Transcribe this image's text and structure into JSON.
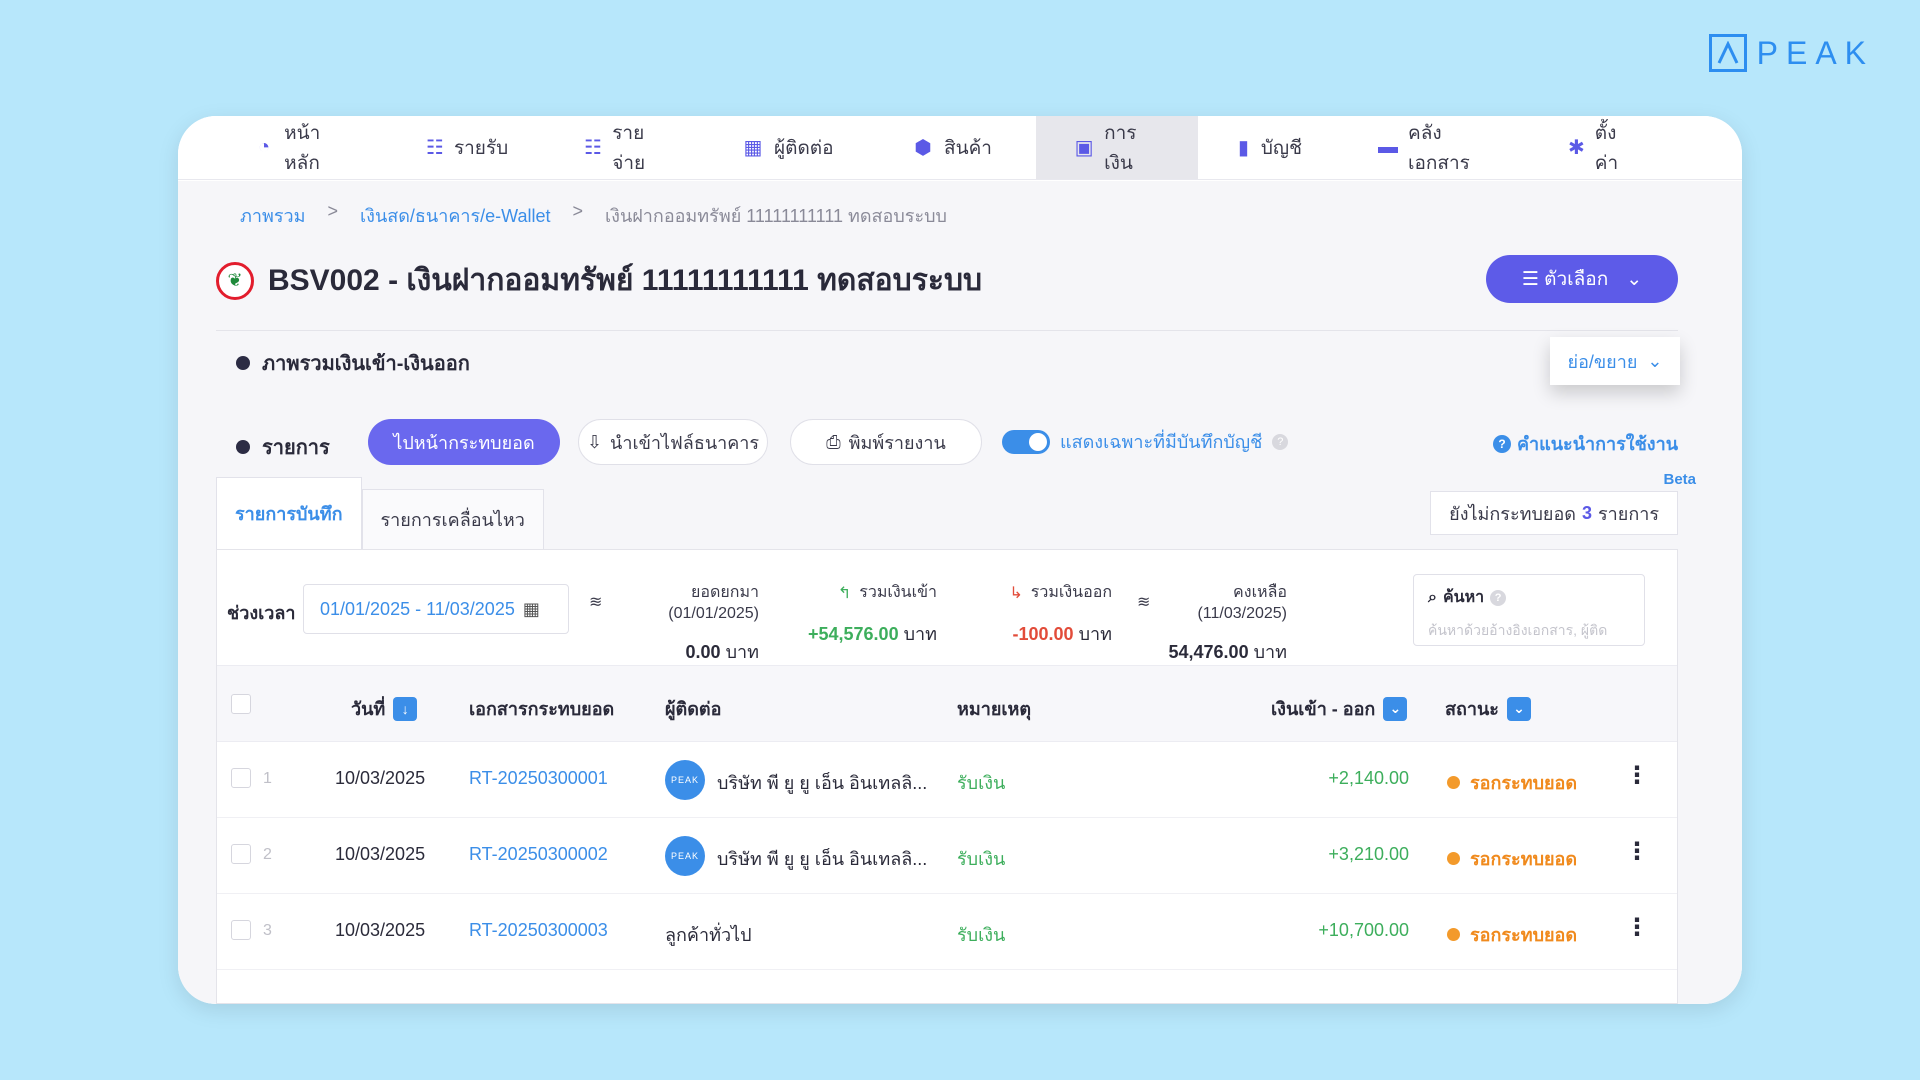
{
  "brand": {
    "name": "PEAK"
  },
  "nav": [
    {
      "label": "หน้าหลัก",
      "icon": "dashboard-icon",
      "glyph": "◔"
    },
    {
      "label": "รายรับ",
      "icon": "income-list-icon",
      "glyph": "☷"
    },
    {
      "label": "รายจ่าย",
      "icon": "expense-list-icon",
      "glyph": "☷"
    },
    {
      "label": "ผู้ติดต่อ",
      "icon": "contacts-icon",
      "glyph": "▦"
    },
    {
      "label": "สินค้า",
      "icon": "product-box-icon",
      "glyph": "⬢"
    },
    {
      "label": "การเงิน",
      "icon": "money-icon",
      "glyph": "▣"
    },
    {
      "label": "บัญชี",
      "icon": "ledger-book-icon",
      "glyph": "▮"
    },
    {
      "label": "คลังเอกสาร",
      "icon": "folder-icon",
      "glyph": "▬"
    },
    {
      "label": "ตั้งค่า",
      "icon": "gear-icon",
      "glyph": "✱"
    }
  ],
  "breadcrumb": {
    "item1": "ภาพรวม",
    "item2": "เงินสด/ธนาคาร/e-Wallet",
    "item3": "เงินฝากออมทรัพย์ 11111111111 ทดสอบระบบ",
    "sep": ">"
  },
  "page": {
    "title": "BSV002 - เงินฝากออมทรัพย์ 11111111111 ทดสอบระบบ",
    "options_label": "ตัวเลือก"
  },
  "overview": {
    "heading": "ภาพรวมเงินเข้า-เงินออก",
    "collapse_label": "ย่อ/ขยาย"
  },
  "transactions": {
    "heading": "รายการ",
    "reconcile_button": "ไปหน้ากระทบยอด",
    "import_button": "นำเข้าไฟล์ธนาคาร",
    "print_button": "พิมพ์รายงาน",
    "toggle_label": "แสดงเฉพาะที่มีบันทึกบัญชี",
    "help_label": "คำแนะนำการใช้งาน",
    "beta": "Beta"
  },
  "tabs": {
    "recorded": "รายการบันทึก",
    "movements": "รายการเคลื่อนไหว"
  },
  "pending": {
    "prefix": "ยังไม่กระทบยอด",
    "count": "3",
    "suffix": "รายการ"
  },
  "filters": {
    "period_label": "ช่วงเวลา",
    "date_range": "01/01/2025 - 11/03/2025",
    "opening": {
      "label": "ยอดยกมา (01/01/2025)",
      "value": "0.00",
      "unit": "บาท"
    },
    "total_in": {
      "label": "รวมเงินเข้า",
      "value": "+54,576.00",
      "unit": "บาท"
    },
    "total_out": {
      "label": "รวมเงินออก",
      "value": "-100.00",
      "unit": "บาท"
    },
    "balance": {
      "label": "คงเหลือ (11/03/2025)",
      "value": "54,476.00",
      "unit": "บาท"
    },
    "search_label": "ค้นหา",
    "search_placeholder": "ค้นหาด้วยอ้างอิงเอกสาร, ผู้ติด"
  },
  "table": {
    "headers": {
      "date": "วันที่",
      "doc": "เอกสารกระทบยอด",
      "contact": "ผู้ติดต่อ",
      "note": "หมายเหตุ",
      "amount": "เงินเข้า - ออก",
      "status": "สถานะ"
    },
    "rows": [
      {
        "num": "1",
        "date": "10/03/2025",
        "doc": "RT-20250300001",
        "contact": "บริษัท พี ยู ยู เอ็น อินเทลลิ...",
        "has_avatar": true,
        "note": "รับเงิน",
        "amount": "+2,140.00",
        "status": "รอกระทบยอด"
      },
      {
        "num": "2",
        "date": "10/03/2025",
        "doc": "RT-20250300002",
        "contact": "บริษัท พี ยู ยู เอ็น อินเทลลิ...",
        "has_avatar": true,
        "note": "รับเงิน",
        "amount": "+3,210.00",
        "status": "รอกระทบยอด"
      },
      {
        "num": "3",
        "date": "10/03/2025",
        "doc": "RT-20250300003",
        "contact": "ลูกค้าทั่วไป",
        "has_avatar": false,
        "note": "รับเงิน",
        "amount": "+10,700.00",
        "status": "รอกระทบยอด"
      }
    ],
    "avatar_text": "PEAK"
  },
  "colors": {
    "primary": "#5d5be8",
    "link": "#3b8ee8",
    "positive": "#3dae5c",
    "negative": "#e24c3a",
    "pending": "#f08a1d",
    "background": "#b7e7fb"
  }
}
